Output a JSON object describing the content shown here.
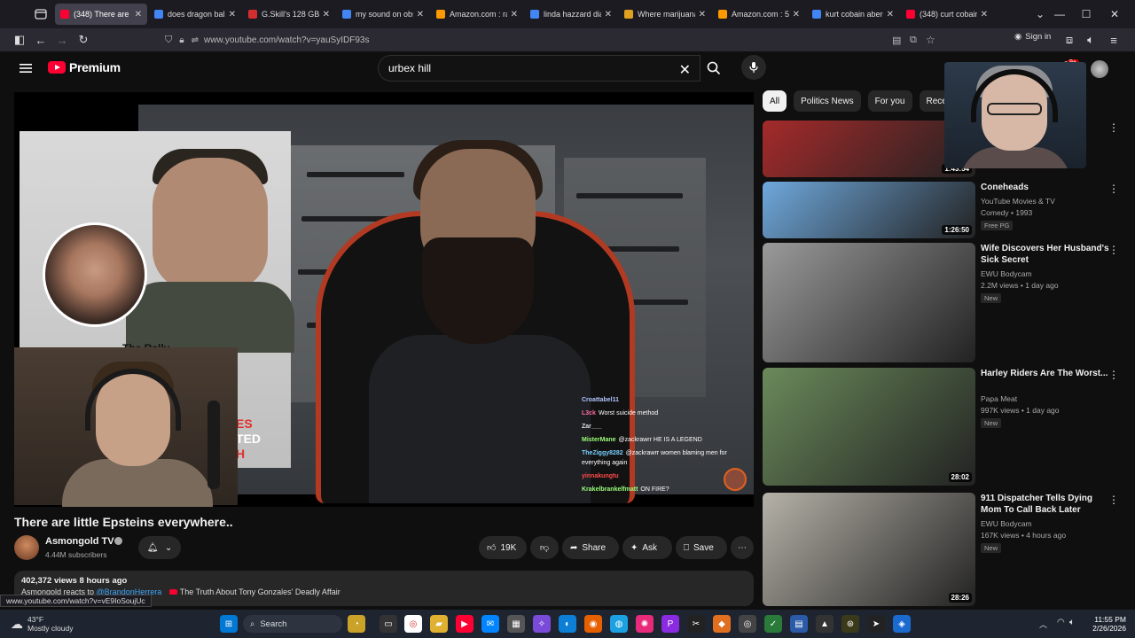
{
  "browser": {
    "tabs": [
      {
        "title": "(348) There are",
        "active": true,
        "fav_color": "#ff0033"
      },
      {
        "title": "does dragon ball",
        "active": false,
        "fav_color": "#4285f4"
      },
      {
        "title": "G.Skill's 128 GB g",
        "active": false,
        "fav_color": "#d32f2f"
      },
      {
        "title": "my sound on obs",
        "active": false,
        "fav_color": "#4285f4"
      },
      {
        "title": "Amazon.com : ram",
        "active": false,
        "fav_color": "#ff9900"
      },
      {
        "title": "linda hazzard diali",
        "active": false,
        "fav_color": "#4285f4"
      },
      {
        "title": "Where marijuana i",
        "active": false,
        "fav_color": "#e0a020"
      },
      {
        "title": "Amazon.com : 50",
        "active": false,
        "fav_color": "#ff9900"
      },
      {
        "title": "kurt cobain aberd",
        "active": false,
        "fav_color": "#4285f4"
      },
      {
        "title": "(348) curt cobain",
        "active": false,
        "fav_color": "#ff0033"
      }
    ],
    "url": "www.youtube.com/watch?v=yauSyIDF93s",
    "sign_in": "Sign in",
    "status_url": "www.youtube.com/watch?v=vE9IoSoujUc"
  },
  "yt": {
    "logo": "Premium",
    "search_value": "urbex hill",
    "notif_badge": "9+"
  },
  "video": {
    "title": "There are little Epsteins everywhere..",
    "channel": "Asmongold TV",
    "subs": "4.44M subscribers",
    "likes": "19K",
    "share": "Share",
    "ask": "Ask",
    "save": "Save",
    "views_time": "402,372 views  8 hours ago",
    "desc_prefix": "Asmongold reacts to ",
    "desc_mention": "@BrandonHerrera",
    "desc_link": "The Truth About Tony Gonzales' Deadly Affair",
    "inset_text_1": "ES",
    "inset_text_2": "TED",
    "inset_text_3": "H",
    "inset_caption": "The Rally"
  },
  "chat": [
    {
      "user": "Croattabel11",
      "msg": "",
      "color": "#b0c4ff"
    },
    {
      "user": "L3ck",
      "msg": "Worst suicide method",
      "color": "#ff6aa0"
    },
    {
      "user": "Zar___",
      "msg": "",
      "color": "#dddddd"
    },
    {
      "user": "MisterMane",
      "msg": "@zackrawrr HE IS A LEGEND",
      "color": "#9aff7a"
    },
    {
      "user": "TheZiggy8282",
      "msg": "@zackrawrr women blaming men for everything again",
      "color": "#7ad0ff"
    },
    {
      "user": "yinnakungtu",
      "msg": "",
      "color": "#ff4a4a"
    },
    {
      "user": "Krakelbrankelfmatt",
      "msg": "ON FIRE?",
      "color": "#9aff7a"
    }
  ],
  "chips": [
    "All",
    "Politics News",
    "For you",
    "Recently"
  ],
  "recs": [
    {
      "title": "",
      "channel": "",
      "meta": "",
      "badge": "",
      "duration": "1:43:54",
      "thumb": "#a52a2a"
    },
    {
      "title": "Coneheads",
      "channel": "YouTube Movies & TV",
      "meta": "Comedy • 1993",
      "badge": "Free  PG",
      "duration": "1:26:50",
      "thumb": "#6fa8dc"
    },
    {
      "title": "Wife Discovers Her Husband's Sick Secret",
      "channel": "EWU Bodycam",
      "meta": "2.2M views • 1 day ago",
      "badge": "New",
      "duration": "",
      "thumb": "#9a9a9a"
    },
    {
      "title": "Harley Riders Are The Worst...",
      "channel": "Papa Meat",
      "meta": "997K views • 1 day ago",
      "badge": "New",
      "duration": "28:02",
      "thumb": "#6a8a5a"
    },
    {
      "title": "911 Dispatcher Tells Dying Mom To Call Back Later",
      "channel": "EWU Bodycam",
      "meta": "167K views • 4 hours ago",
      "badge": "New",
      "duration": "28:26",
      "thumb": "#b6b2a8"
    }
  ],
  "taskbar": {
    "temp": "43°F",
    "weather": "Mostly cloudy",
    "search": "Search",
    "time": "11:55 PM",
    "date": "2/26/2026"
  }
}
